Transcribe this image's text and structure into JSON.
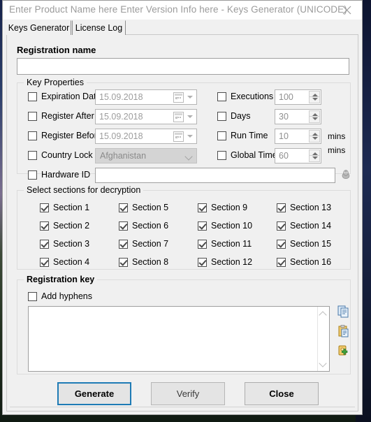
{
  "window": {
    "title": "Enter Product Name here Enter Version Info here - Keys Generator (UNICODE)",
    "close_label": "✕"
  },
  "tabs": [
    {
      "label": "Keys Generator",
      "active": true
    },
    {
      "label": "License Log",
      "active": false
    }
  ],
  "registration_name": {
    "title": "Registration name",
    "value": "",
    "placeholder": ""
  },
  "key_properties": {
    "legend": "Key Properties",
    "left_rows": [
      {
        "checkbox": "Expiration Date",
        "control": "date",
        "value": "15.09.2018",
        "checked": false
      },
      {
        "checkbox": "Register After",
        "control": "date",
        "value": "15.09.2018",
        "checked": false
      },
      {
        "checkbox": "Register Before",
        "control": "date",
        "value": "15.09.2018",
        "checked": false
      },
      {
        "checkbox": "Country Lock",
        "control": "combo",
        "value": "Afghanistan",
        "checked": false
      },
      {
        "checkbox": "Hardware ID",
        "control": "text",
        "value": "",
        "checked": false
      }
    ],
    "right_rows": [
      {
        "checkbox": "Executions",
        "value": "100",
        "unit": "",
        "checked": false
      },
      {
        "checkbox": "Days",
        "value": "30",
        "unit": "",
        "checked": false
      },
      {
        "checkbox": "Run Time",
        "value": "10",
        "unit": "mins",
        "checked": false
      },
      {
        "checkbox": "Global Time",
        "value": "60",
        "unit": "mins",
        "checked": false
      }
    ],
    "hardware_icon": "fingerprint-icon"
  },
  "sections": {
    "legend": "Select sections for decryption",
    "items": [
      {
        "label": "Section 1",
        "checked": true
      },
      {
        "label": "Section 5",
        "checked": true
      },
      {
        "label": "Section 9",
        "checked": true
      },
      {
        "label": "Section 13",
        "checked": true
      },
      {
        "label": "Section 2",
        "checked": true
      },
      {
        "label": "Section 6",
        "checked": true
      },
      {
        "label": "Section 10",
        "checked": true
      },
      {
        "label": "Section 14",
        "checked": true
      },
      {
        "label": "Section 3",
        "checked": true
      },
      {
        "label": "Section 7",
        "checked": true
      },
      {
        "label": "Section 11",
        "checked": true
      },
      {
        "label": "Section 15",
        "checked": true
      },
      {
        "label": "Section 4",
        "checked": true
      },
      {
        "label": "Section 8",
        "checked": true
      },
      {
        "label": "Section 12",
        "checked": true
      },
      {
        "label": "Section 16",
        "checked": true
      }
    ]
  },
  "registration_key": {
    "legend": "Registration key",
    "add_hyphens_label": "Add hyphens",
    "add_hyphens_checked": false,
    "value": "",
    "side_icons": [
      "copy-icon",
      "paste-icon",
      "add-license-icon"
    ]
  },
  "buttons": {
    "generate": "Generate",
    "verify": "Verify",
    "close": "Close"
  },
  "colors": {
    "accent": "#1e7bb5",
    "window_bg": "#f0f0f0",
    "field_bg": "#ffffff",
    "disabled_bg": "#d4d4d4",
    "title_text": "#9b9b9b"
  }
}
